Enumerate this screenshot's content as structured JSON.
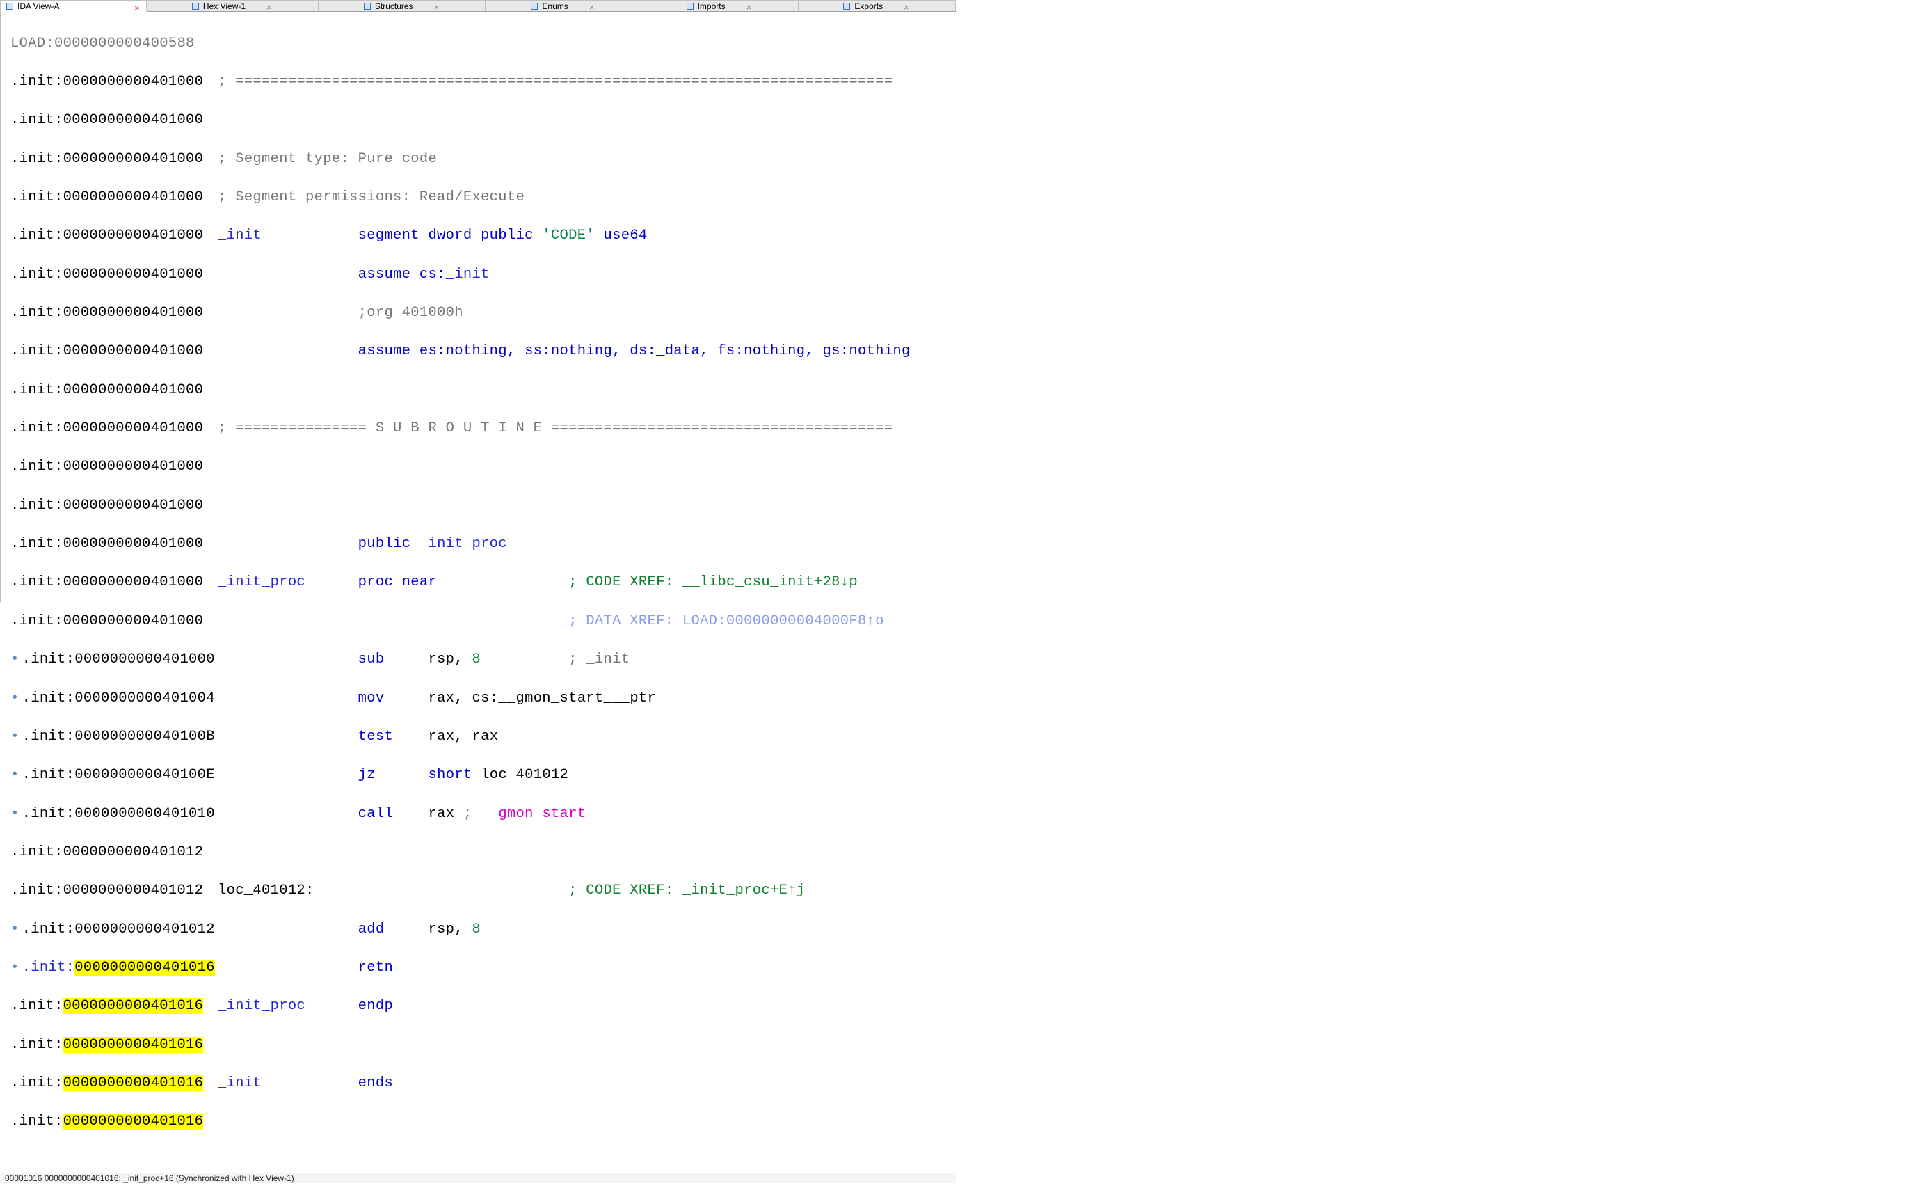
{
  "tabs": [
    {
      "label": "IDA View-A",
      "active": true
    },
    {
      "label": "Hex View-1",
      "active": false
    },
    {
      "label": "Structures",
      "active": false
    },
    {
      "label": "Enums",
      "active": false
    },
    {
      "label": "Imports",
      "active": false
    },
    {
      "label": "Exports",
      "active": false
    }
  ],
  "load_line": "LOAD:0000000000400588",
  "addrs": {
    "init1000": ".init:0000000000401000",
    "init1004": ".init:0000000000401004",
    "init100B": ".init:000000000040100B",
    "init100E": ".init:000000000040100E",
    "init1010": ".init:0000000000401010",
    "init1012": ".init:0000000000401012",
    "init1016_seg": ".init:",
    "init1016_addr": "0000000000401016"
  },
  "text": {
    "sep": "; ===========================================================================",
    "segtype": "; Segment type: Pure code",
    "segperm": "; Segment permissions: Read/Execute",
    "init_label": "_init",
    "seg_decl1": "segment dword public ",
    "seg_code": "'CODE'",
    "seg_use": " use64",
    "assume_cs": "assume cs:",
    "init_ref": "_init",
    "org": ";org 401000h",
    "assume_rest": "assume es:nothing, ss:nothing, ds:_data, fs:nothing, gs:nothing",
    "sub_sep_l": "; =============== ",
    "sub_text": "S U B R O U T I N E",
    "sub_sep_r": " =======================================",
    "public": "public ",
    "init_proc": "_init_proc",
    "proc_near": "proc near",
    "code_xref1": "; CODE XREF: __libc_csu_init+28↓p",
    "data_xref": "; DATA XREF: LOAD:00000000004000F8↑o",
    "sub": "sub",
    "rsp8": "rsp, ",
    "n8": "8",
    "cmt_init": "; _init",
    "mov": "mov",
    "mov_ops": "rax, cs:__gmon_start___ptr",
    "test": "test",
    "test_ops": "rax, rax",
    "jz": "jz",
    "short": "short ",
    "loc_401012": "loc_401012",
    "call": "call",
    "call_op": "rax ",
    "call_cmt": "; ",
    "gmon": "__gmon_start__",
    "loc_label": "loc_401012:",
    "code_xref2": "; CODE XREF: _init_proc+E↑j",
    "add": "add",
    "retn": "retn",
    "endp": "endp",
    "ends": "ends"
  },
  "statusbar": "00001016 0000000000401016: _init_proc+16 (Synchronized with Hex View-1)"
}
